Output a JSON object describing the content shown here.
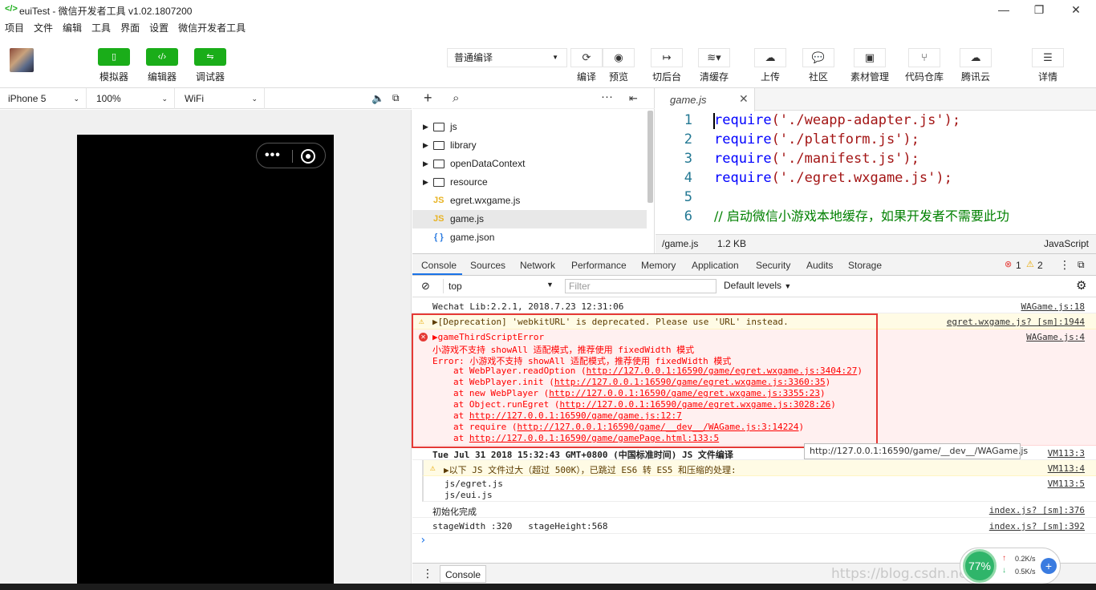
{
  "window": {
    "title": "euiTest - 微信开发者工具 v1.02.1807200",
    "minimize": "—",
    "maximize": "❐",
    "close": "✕"
  },
  "menu": [
    "项目",
    "文件",
    "编辑",
    "工具",
    "界面",
    "设置",
    "微信开发者工具"
  ],
  "toolbar": {
    "mode_buttons": [
      {
        "label": "模拟器",
        "icon": "phone-icon"
      },
      {
        "label": "编辑器",
        "icon": "code-icon"
      },
      {
        "label": "调试器",
        "icon": "debug-icon"
      }
    ],
    "compile_mode": "普通编译",
    "actions": [
      {
        "label": "编译",
        "icon": "refresh-icon"
      },
      {
        "label": "预览",
        "icon": "eye-icon"
      },
      {
        "label": "切后台",
        "icon": "switch-background-icon"
      },
      {
        "label": "清缓存",
        "icon": "layers-icon"
      },
      {
        "label": "上传",
        "icon": "cloud-upload-icon"
      },
      {
        "label": "社区",
        "icon": "chat-icon"
      },
      {
        "label": "素材管理",
        "icon": "material-icon"
      },
      {
        "label": "代码仓库",
        "icon": "branch-icon"
      },
      {
        "label": "腾讯云",
        "icon": "cloud-icon"
      },
      {
        "label": "详情",
        "icon": "menu-icon"
      }
    ]
  },
  "device": {
    "model": "iPhone 5",
    "zoom": "100%",
    "network": "WiFi"
  },
  "filetree": {
    "items": [
      {
        "type": "folder",
        "name": "js"
      },
      {
        "type": "folder",
        "name": "library"
      },
      {
        "type": "folder",
        "name": "openDataContext"
      },
      {
        "type": "folder",
        "name": "resource"
      },
      {
        "type": "js",
        "name": "egret.wxgame.js"
      },
      {
        "type": "js",
        "name": "game.js"
      },
      {
        "type": "json",
        "name": "game.json"
      }
    ]
  },
  "editor": {
    "tab": "game.js",
    "lines": [
      {
        "n": "1",
        "kw": "require",
        "arg": "('./weapp-adapter.js');"
      },
      {
        "n": "2",
        "kw": "require",
        "arg": "('./platform.js');"
      },
      {
        "n": "3",
        "kw": "require",
        "arg": "('./manifest.js');"
      },
      {
        "n": "4",
        "kw": "require",
        "arg": "('./egret.wxgame.js');"
      },
      {
        "n": "5",
        "kw": "",
        "arg": ""
      },
      {
        "n": "6",
        "comment": "// 启动微信小游戏本地缓存，如果开发者不需要此功"
      }
    ],
    "status_path": "/game.js",
    "status_size": "1.2 KB",
    "status_lang": "JavaScript"
  },
  "devtools": {
    "tabs": [
      "Console",
      "Sources",
      "Network",
      "Performance",
      "Memory",
      "Application",
      "Security",
      "Audits",
      "Storage"
    ],
    "errors": "1",
    "warnings": "2",
    "context": "top",
    "filter_placeholder": "Filter",
    "levels": "Default levels"
  },
  "console": {
    "l1": {
      "msg": "Wechat Lib:2.2.1, 2018.7.23 12:31:06",
      "src": "WAGame.js:18"
    },
    "l2": {
      "msg": "▶[Deprecation] 'webkitURL' is deprecated. Please use 'URL' instead.",
      "src": "egret.wxgame.js? [sm]:1944"
    },
    "l3": {
      "head": "▶gameThirdScriptError",
      "src": "WAGame.js:4",
      "m1": "小游戏不支持 showAll 适配模式，推荐使用 fixedWidth 模式",
      "m2": "Error: 小游戏不支持 showAll 适配模式，推荐使用 fixedWidth 模式",
      "stack": [
        {
          "pre": "at WebPlayer.readOption (",
          "url": "http://127.0.0.1:16590/game/egret.wxgame.js:3404:27",
          "post": ")"
        },
        {
          "pre": "at WebPlayer.init (",
          "url": "http://127.0.0.1:16590/game/egret.wxgame.js:3360:35",
          "post": ")"
        },
        {
          "pre": "at new WebPlayer (",
          "url": "http://127.0.0.1:16590/game/egret.wxgame.js:3355:23",
          "post": ")"
        },
        {
          "pre": "at Object.runEgret (",
          "url": "http://127.0.0.1:16590/game/egret.wxgame.js:3028:26",
          "post": ")"
        },
        {
          "pre": "at ",
          "url": "http://127.0.0.1:16590/game/game.js:12:7",
          "post": ""
        },
        {
          "pre": "at require (",
          "url": "http://127.0.0.1:16590/game/__dev__/WAGame.js:3:14224",
          "post": ")"
        },
        {
          "pre": "at ",
          "url": "http://127.0.0.1:16590/game/gamePage.html:133:5",
          "post": ""
        }
      ]
    },
    "l4": {
      "msg": "Tue Jul 31 2018 15:32:43 GMT+0800 (中国标准时间) JS 文件编译",
      "src": "VM113:3"
    },
    "l5": {
      "msg": "▶以下 JS 文件过大（超过 500K），已跳过 ES6 转 ES5 和压缩的处理:",
      "src": "VM113:4"
    },
    "l6": {
      "a": "js/egret.js",
      "b": "js/eui.js",
      "src": "VM113:5"
    },
    "l7": {
      "msg": "初始化完成",
      "src": "index.js? [sm]:376"
    },
    "l8": {
      "msg": "stageWidth :320   stageHeight:568",
      "src": "index.js? [sm]:392"
    },
    "prompt": "›",
    "tooltip": "http://127.0.0.1:16590/game/__dev__/WAGame.js"
  },
  "bottom": {
    "tab": "Console"
  },
  "net": {
    "percent": "77%",
    "up": "0.2K/s",
    "down": "0.5K/s"
  },
  "watermark": "https://blog.csdn.net/u01360338"
}
